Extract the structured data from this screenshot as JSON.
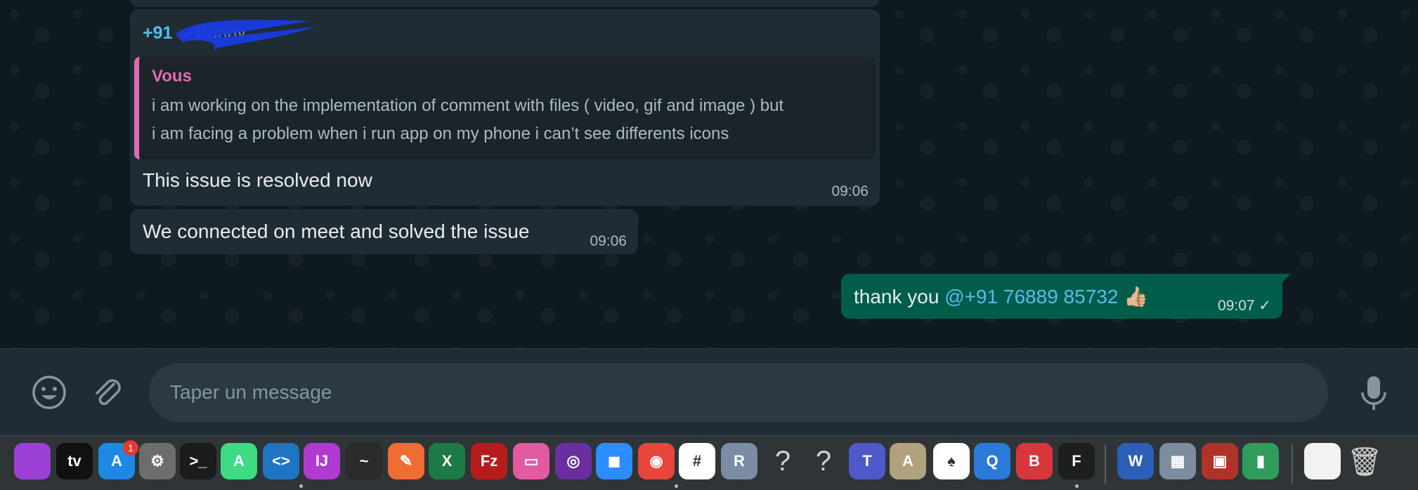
{
  "chat": {
    "reply_message": {
      "sender_phone": "+91",
      "sender_name": "~Bunny",
      "quoted_author": "Vous",
      "quoted_text_line1": "i am working on the implementation of comment with files ( video, gif and image ) but",
      "quoted_text_line2": "i am facing a problem when i run app on my phone i can’t see differents icons",
      "text": "This issue is resolved now",
      "time": "09:06"
    },
    "second_message": {
      "text": "We connected on meet and solved the issue",
      "time": "09:06"
    },
    "outgoing_message": {
      "text": "thank you ",
      "mention": "@+91 76889 85732",
      "emoji": "👍🏼",
      "time": "09:07 ✓"
    }
  },
  "composer": {
    "placeholder": "Taper un message"
  },
  "dock": {
    "appstore_badge": "1",
    "apps": [
      {
        "id": "podcasts",
        "label": "",
        "color": "#9b3fd6"
      },
      {
        "id": "appletv",
        "label": "tv",
        "color": "#111111"
      },
      {
        "id": "appstore",
        "label": "A",
        "color": "#1e88e5"
      },
      {
        "id": "system-preferences",
        "label": "⚙",
        "color": "#6d6d6d"
      },
      {
        "id": "terminal",
        "label": ">_",
        "color": "#1b1b1b"
      },
      {
        "id": "android-studio",
        "label": "A",
        "color": "#3ddc84"
      },
      {
        "id": "vscode",
        "label": "<>",
        "color": "#1f74c4"
      },
      {
        "id": "intellij",
        "label": "IJ",
        "color": "#b03ad0"
      },
      {
        "id": "activity-monitor",
        "label": "~",
        "color": "#2a2a2a"
      },
      {
        "id": "postman",
        "label": "✎",
        "color": "#ef6c33"
      },
      {
        "id": "excel",
        "label": "X",
        "color": "#1e7a45"
      },
      {
        "id": "filezilla",
        "label": "Fz",
        "color": "#b71c1c"
      },
      {
        "id": "cleanmymac",
        "label": "▭",
        "color": "#e35aa0"
      },
      {
        "id": "tor",
        "label": "◎",
        "color": "#6a2ea0"
      },
      {
        "id": "zoom",
        "label": "◼",
        "color": "#2d8cff"
      },
      {
        "id": "chrome",
        "label": "◉",
        "color": "#e8453c"
      },
      {
        "id": "slack",
        "label": "#",
        "color": "#ffffff"
      },
      {
        "id": "rstudio",
        "label": "R",
        "color": "#7a8da5"
      },
      {
        "id": "unknown-1",
        "label": "?",
        "color": "transparent"
      },
      {
        "id": "unknown-2",
        "label": "?",
        "color": "transparent"
      },
      {
        "id": "teams",
        "label": "T",
        "color": "#5059c9"
      },
      {
        "id": "xcode-instruments",
        "label": "A",
        "color": "#b0a27c"
      },
      {
        "id": "mongodb",
        "label": "♠",
        "color": "#ffffff"
      },
      {
        "id": "quicktime",
        "label": "Q",
        "color": "#2a7ad9"
      },
      {
        "id": "bear",
        "label": "B",
        "color": "#d9363b"
      },
      {
        "id": "figma",
        "label": "F",
        "color": "#1e1e1e"
      },
      {
        "id": "word",
        "label": "W",
        "color": "#2b5fb8"
      },
      {
        "id": "preview",
        "label": "▦",
        "color": "#7b8d9f"
      },
      {
        "id": "photo-booth",
        "label": "▣",
        "color": "#b0332a"
      },
      {
        "id": "numbers",
        "label": "▮",
        "color": "#2e9c5a"
      },
      {
        "id": "documents",
        "label": "",
        "color": "#f2f2f2"
      },
      {
        "id": "trash",
        "label": "🗑",
        "color": "transparent"
      }
    ]
  }
}
